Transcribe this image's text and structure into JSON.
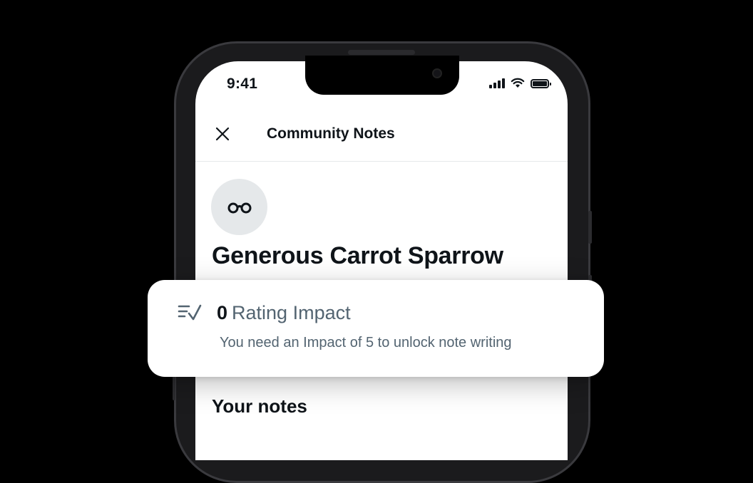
{
  "status_bar": {
    "time": "9:41",
    "icons": [
      "signal-icon",
      "wifi-icon",
      "battery-icon"
    ]
  },
  "header": {
    "close_icon": "close-icon",
    "title": "Community Notes"
  },
  "profile": {
    "avatar_icon": "glasses-icon",
    "name": "Generous Carrot Sparrow"
  },
  "impact_card": {
    "icon": "rating-check-icon",
    "value": "0",
    "label": "Rating Impact",
    "subtitle": "You need an Impact of 5 to unlock note writing"
  },
  "sections": {
    "your_notes_title": "Your notes"
  },
  "colors": {
    "background": "#000000",
    "screen": "#ffffff",
    "primary_text": "#0f1419",
    "secondary_text": "#536471",
    "avatar_bg": "#e5e8ea"
  }
}
